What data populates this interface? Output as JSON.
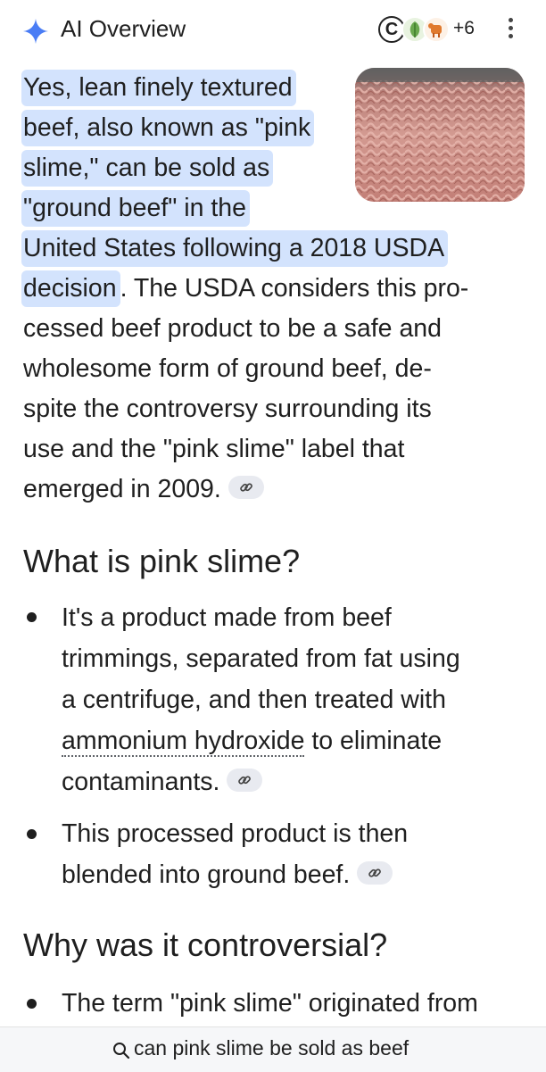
{
  "header": {
    "spark_icon": "ai-sparkle-icon",
    "title": "AI Overview",
    "sources": [
      "c-logo-icon",
      "leaf-logo-icon",
      "cow-logo-icon"
    ],
    "more_sources": "+6",
    "menu_icon": "more-vert-icon",
    "accent": "#4285f4"
  },
  "overview": {
    "image_alt": "ground-beef-image",
    "lines": [
      "Yes, lean finely textured",
      "beef, also known as \"pink",
      "slime,\" can be sold as",
      "\"ground beef\" in the",
      "United States following a 2018 USDA",
      "decision",
      ". The USDA considers this pro-",
      "cessed beef product to be a safe and",
      "wholesome form of ground beef, de-",
      "spite the controversy surrounding its",
      "use and the \"pink slime\" label that",
      "emerged in 2009."
    ],
    "highlight_color": "#d3e3fd"
  },
  "section1": {
    "heading": "What is pink slime?",
    "bullet1": {
      "line1": "It's a product made from beef",
      "line2": "trimmings, separated from fat using",
      "line3": "a centrifuge, and then treated with",
      "term": "ammonium hydroxide",
      "line4_rest": " to eliminate",
      "line5": "contaminants."
    },
    "bullet2": {
      "line1": "This processed product is then",
      "line2": "blended into ground beef."
    }
  },
  "section2": {
    "heading": "Why was it controversial?",
    "bullet1": {
      "line1": "The term \"pink slime\" originated from"
    }
  },
  "search_bar": {
    "query": "can pink slime be sold as beef",
    "icon": "search-icon"
  },
  "link_icon": "link-icon"
}
